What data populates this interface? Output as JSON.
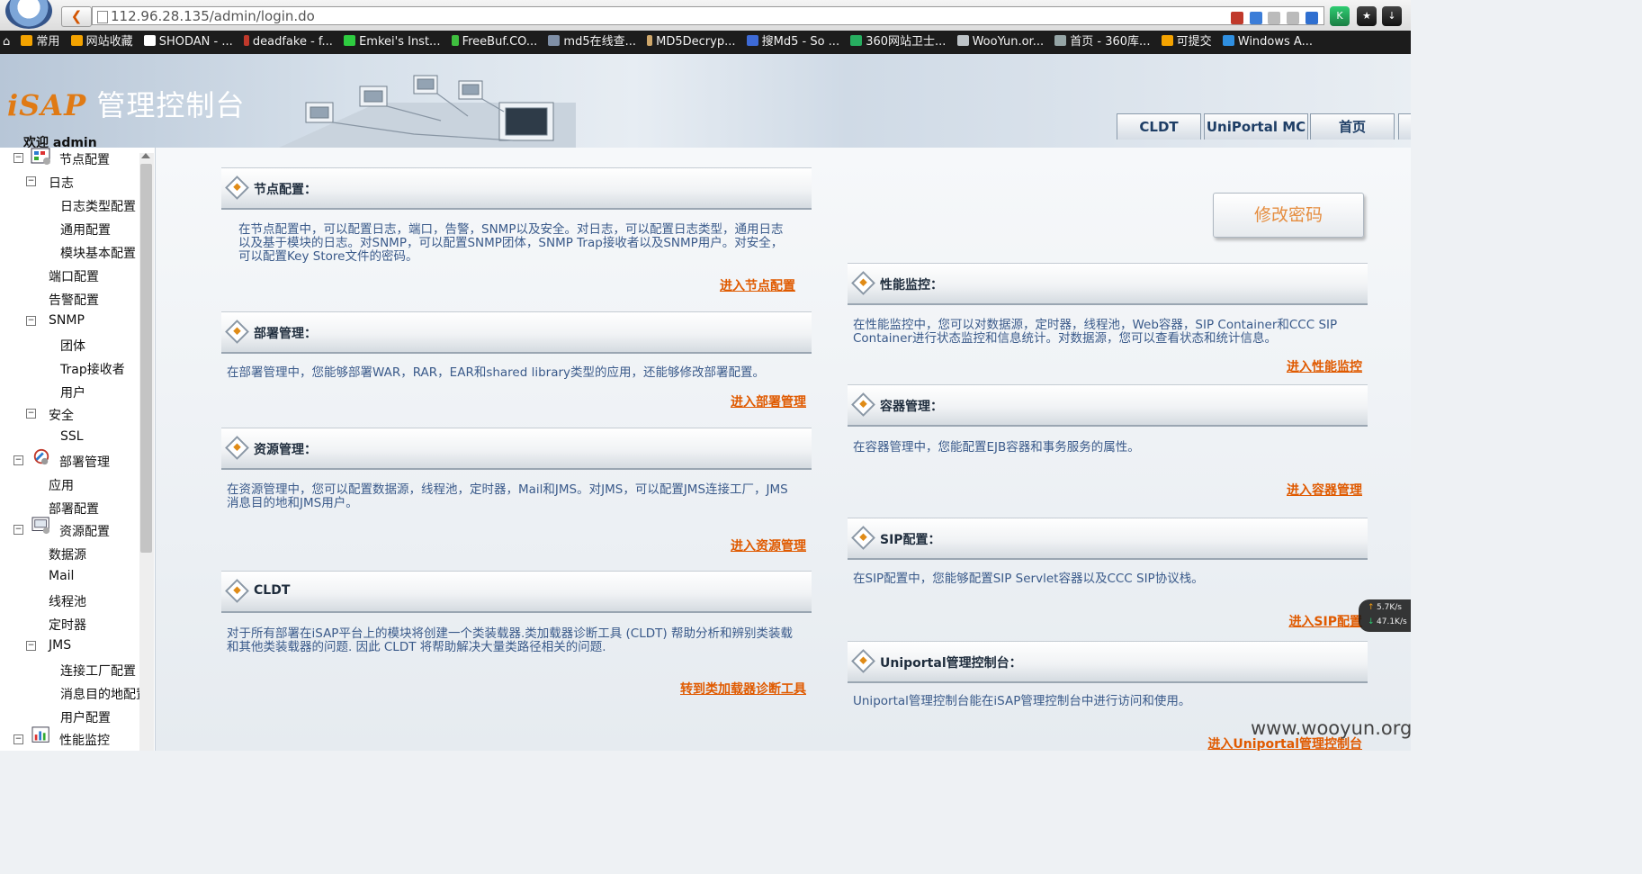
{
  "browser": {
    "url": "112.96.28.135/admin/login.do",
    "addr_tools": "译 ▣ ☆ ☰ ⟳"
  },
  "bookmarks": [
    {
      "label": "常用",
      "color": "#f4a300"
    },
    {
      "label": "网站收藏",
      "color": "#f4a300"
    },
    {
      "label": "SHODAN - ...",
      "color": "#ffffff"
    },
    {
      "label": "deadfake - f...",
      "color": "#c0392b"
    },
    {
      "label": "Emkei's Inst...",
      "color": "#2ecc40"
    },
    {
      "label": "FreeBuf.CO...",
      "color": "#3fbf3f"
    },
    {
      "label": "md5在线查...",
      "color": "#7f8fa6"
    },
    {
      "label": "MD5Decryp...",
      "color": "#cfa76a"
    },
    {
      "label": "搜Md5 - So ...",
      "color": "#3d6ad6"
    },
    {
      "label": "360网站卫士...",
      "color": "#27ae60"
    },
    {
      "label": "WooYun.or...",
      "color": "#bdc3c7"
    },
    {
      "label": "首页 - 360库...",
      "color": "#95a5a6"
    },
    {
      "label": "可提交",
      "color": "#f4a300"
    },
    {
      "label": "Windows A...",
      "color": "#2f8fe0"
    }
  ],
  "header": {
    "brand_prefix": "iSAP",
    "brand_suffix": "管理控制台",
    "welcome": "欢迎 admin",
    "tabs": [
      "CLDT",
      "UniPortal MC",
      "首页"
    ]
  },
  "tree": [
    {
      "label": "节点配置",
      "toggle": "−"
    },
    {
      "label": "日志",
      "toggle": "−"
    },
    {
      "label": "日志类型配置"
    },
    {
      "label": "通用配置"
    },
    {
      "label": "模块基本配置"
    },
    {
      "label": "端口配置"
    },
    {
      "label": "告警配置"
    },
    {
      "label": "SNMP",
      "toggle": "−"
    },
    {
      "label": "团体"
    },
    {
      "label": "Trap接收者"
    },
    {
      "label": "用户"
    },
    {
      "label": "安全",
      "toggle": "−"
    },
    {
      "label": "SSL"
    },
    {
      "label": "部署管理",
      "toggle": "−"
    },
    {
      "label": "应用"
    },
    {
      "label": "部署配置"
    },
    {
      "label": "资源配置",
      "toggle": "−"
    },
    {
      "label": "数据源"
    },
    {
      "label": "Mail"
    },
    {
      "label": "线程池"
    },
    {
      "label": "定时器"
    },
    {
      "label": "JMS",
      "toggle": "−"
    },
    {
      "label": "连接工厂配置"
    },
    {
      "label": "消息目的地配置"
    },
    {
      "label": "用户配置"
    },
    {
      "label": "性能监控",
      "toggle": "−"
    }
  ],
  "panels": {
    "node": {
      "title": "节点配置：",
      "desc": [
        "在节点配置中，可以配置日志，端口，告警，SNMP以及安全。对日志，可以配置日志类型，通用日志",
        "以及基于模块的日志。对SNMP，可以配置SNMP团体，SNMP Trap接收者以及SNMP用户。对安全，",
        "可以配置Key Store文件的密码。"
      ],
      "link": "进入节点配置"
    },
    "deploy": {
      "title": "部署管理：",
      "desc": [
        "在部署管理中，您能够部署WAR，RAR，EAR和shared library类型的应用，还能够修改部署配置。"
      ],
      "link": "进入部署管理"
    },
    "resource": {
      "title": "资源管理：",
      "desc": [
        "在资源管理中，您可以配置数据源，线程池，定时器，Mail和JMS。对JMS，可以配置JMS连接工厂，JMS",
        "消息目的地和JMS用户。"
      ],
      "link": "进入资源管理"
    },
    "cldt": {
      "title": "CLDT",
      "desc": [
        "对于所有部署在iSAP平台上的模块将创建一个类装载器.类加载器诊断工具 (CLDT) 帮助分析和辨别类装载",
        "和其他类装载器的问题. 因此 CLDT 将帮助解决大量类路径相关的问题."
      ],
      "link": "转到类加载器诊断工具"
    },
    "perf": {
      "title": "性能监控：",
      "desc": [
        "在性能监控中，您可以对数据源，定时器，线程池，Web容器，SIP Container和CCC SIP",
        "Container进行状态监控和信息统计。对数据源，您可以查看状态和统计信息。"
      ],
      "link": "进入性能监控"
    },
    "container": {
      "title": "容器管理：",
      "desc": [
        "在容器管理中，您能配置EJB容器和事务服务的属性。"
      ],
      "link": "进入容器管理"
    },
    "sip": {
      "title": "SIP配置：",
      "desc": [
        "在SIP配置中，您能够配置SIP Servlet容器以及CCC SIP协议栈。"
      ],
      "link": "进入SIP配置"
    },
    "uniportal": {
      "title": "Uniportal管理控制台：",
      "desc": [
        "Uniportal管理控制台能在iSAP管理控制台中进行访问和使用。"
      ],
      "link": "进入Uniportal管理控制台"
    }
  },
  "change_password": "修改密码",
  "net_speed": {
    "up": "5.7K/s",
    "down": "47.1K/s"
  },
  "watermark": "www.wooyun.org"
}
